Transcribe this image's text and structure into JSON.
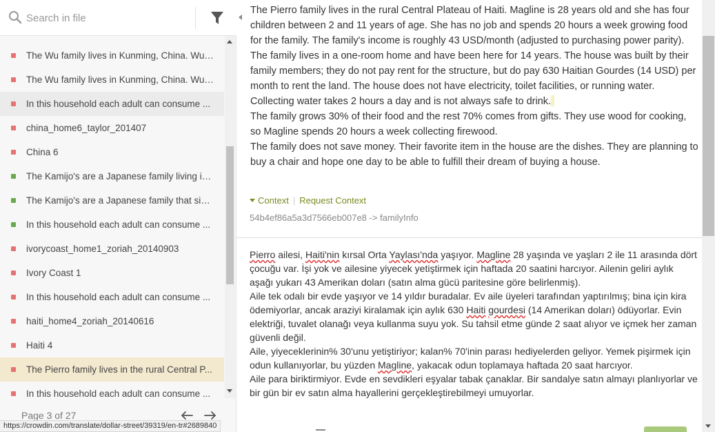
{
  "search": {
    "placeholder": "Search in file"
  },
  "list": {
    "items": [
      {
        "text": "The Wu family lives in Kunming, China. Wul...",
        "status": "red"
      },
      {
        "text": "The Wu family lives in Kunming, China. Wul...",
        "status": "red"
      },
      {
        "text": "In this household each adult can consume ...",
        "status": "red"
      },
      {
        "text": "china_home6_taylor_201407",
        "status": "red"
      },
      {
        "text": "China 6",
        "status": "red"
      },
      {
        "text": "The Kamijo's are a Japanese family living in ...",
        "status": "green"
      },
      {
        "text": "The Kamijo's are a Japanese family that six ...",
        "status": "green"
      },
      {
        "text": "In this household each adult can consume ...",
        "status": "green"
      },
      {
        "text": "ivorycoast_home1_zoriah_20140903",
        "status": "red"
      },
      {
        "text": "Ivory Coast 1",
        "status": "red"
      },
      {
        "text": "In this household each adult can consume ...",
        "status": "red"
      },
      {
        "text": "haiti_home4_zoriah_20140616",
        "status": "red"
      },
      {
        "text": "Haiti 4",
        "status": "red"
      },
      {
        "text": "The Pierro family lives in the rural Central P...",
        "status": "red"
      },
      {
        "text": "In this household each adult can consume ...",
        "status": "red"
      }
    ]
  },
  "pager": {
    "label": "Page 3 of 27"
  },
  "statusbar": {
    "url": "https://crowdin.com/translate/dollar-street/39319/en-tr#2689840"
  },
  "source": {
    "paragraphs": [
      "The Pierro family lives in the rural Central Plateau of Haiti. Magline is 28 years old and she has four children between 2 and 11 years of age. She has no job and spends 20 hours a week growing food for the family. The family's income is roughly 43 USD/month (adjusted to purchasing power parity).",
      "The family lives in a one-room home and have been here for 14 years. The house was built by their family members; they do not pay rent for the structure, but do pay 630 Haitian Gourdes (14 USD) per month to rent the land. The house does not have electricity, toilet facilities, or running water. Collecting water takes 2 hours a day and is not always safe to drink.",
      "The family grows 30% of their food and the rest 70% comes from gifts. They use wood for cooking, so Magline spends 20 hours a week collecting firewood.",
      "The family does not save money. Their favorite item in the house are the dishes. They are planning to buy a chair and hope one day to be able to fulfill their dream of buying a house."
    ]
  },
  "context": {
    "context_label": "Context",
    "request_label": "Request Context",
    "key": "54b4ef86a5a3d7566eb007e8 -> familyInfo"
  },
  "translation": {
    "p1_a": "Pierro",
    "p1_b": " ailesi, ",
    "p1_c": "Haiti'nin",
    "p1_d": " kırsal Orta ",
    "p1_e": "Yaylası'nda",
    "p1_f": " yaşıyor. ",
    "p1_g": "Magline",
    "p1_h": " 28 yaşında ve yaşları 2 ile 11 arasında dört çocuğu var. İşi yok ve ailesine yiyecek yetiştirmek için haftada 20 saatini harcıyor. Ailenin geliri aylık aşağı yukarı 43 Amerikan doları (satın alma gücü paritesine göre belirlenmiş).",
    "p2_a": "Aile tek odalı bir evde yaşıyor ve 14 yıldır buradalar. Ev aile üyeleri tarafından yaptırılmış; bina için kira ödemiyorlar, ancak araziyi kiralamak için aylık 630 ",
    "p2_b": "Haiti",
    "p2_c": " ",
    "p2_d": "gourdesi",
    "p2_e": " (14 Amerikan doları) ödüyorlar. Evin elektriği, tuvalet olanağı veya kullanma suyu yok. Su tahsil etme günde 2 saat alıyor ve içmek her zaman güvenli değil.",
    "p3_a": "Aile, yiyeceklerinin% 30'unu yetiştiriyor; kalan% 70'inin parası hediyelerden geliyor. Yemek pişirmek için odun kullanıyorlar, bu yüzden ",
    "p3_b": "Magline",
    "p3_c": ", yakacak odun toplamaya haftada 20 saat harcıyor.",
    "p4": "Aile para biriktirmiyor. Evde en sevdikleri eşyalar tabak çanaklar. Bir sandalye satın almayı planlıyorlar ve bir gün bir ev satın alma hayallerini gerçekleştirebilmeyi umuyorlar."
  },
  "colors": {
    "accent": "#7a8a1f",
    "active_row": "#f3e9cf",
    "status_red": "#e57373",
    "status_green": "#6aa84f"
  }
}
